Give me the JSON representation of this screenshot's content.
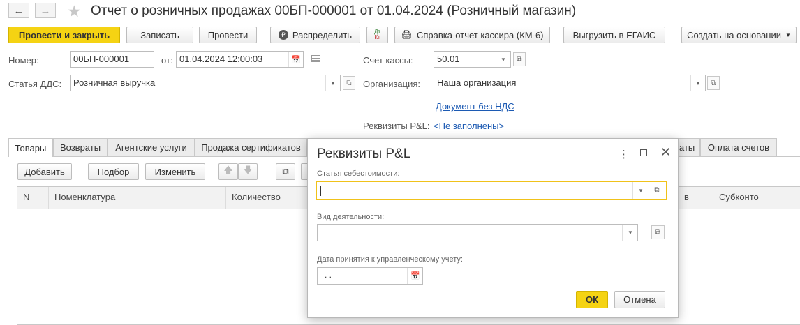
{
  "window": {
    "title": "Отчет о розничных продажах 00БП-000001 от 01.04.2024 (Розничный магазин)",
    "back_icon": "arrow-left-icon",
    "forward_icon": "arrow-right-icon",
    "favorite_icon": "star-icon"
  },
  "toolbar": {
    "post_close": "Провести и закрыть",
    "save": "Записать",
    "post": "Провести",
    "distribute": "Распределить",
    "report_kassir": "Справка-отчет кассира (КМ-6)",
    "egais": "Выгрузить в ЕГАИС",
    "create_based": "Создать на основании",
    "dtkt_dt": "Дт",
    "dtkt_kt": "Кт"
  },
  "header": {
    "number_label": "Номер:",
    "number_value": "00БП-000001",
    "date_label": "от:",
    "date_value": "01.04.2024 12:00:03",
    "kassa_label": "Счет кассы:",
    "kassa_value": "50.01",
    "dds_label": "Статья ДДС:",
    "dds_value": "Розничная выручка",
    "org_label": "Организация:",
    "org_value": "Наша организация",
    "vat_link": "Документ без НДС",
    "pl_label": "Реквизиты P&L:",
    "pl_link": "<Не заполнены>"
  },
  "tabs": {
    "goods": "Товары",
    "returns": "Возвраты",
    "agent": "Агентские услуги",
    "certs": "Продажа сертификатов",
    "hidden_partial": "аты",
    "payments": "Оплата счетов"
  },
  "table_toolbar": {
    "add": "Добавить",
    "pick": "Подбор",
    "change": "Изменить"
  },
  "table": {
    "col_n": "N",
    "col_item": "Номенклатура",
    "col_qty": "Количество",
    "col_hidden_partial": "в",
    "col_subconto": "Субконто"
  },
  "dialog": {
    "title": "Реквизиты P&L",
    "cost_label": "Статья себестоимости:",
    "cost_value": "",
    "activity_label": "Вид деятельности:",
    "activity_value": "",
    "date_label": "Дата принятия к управленческому учету:",
    "date_value": " .  .",
    "ok": "ОК",
    "cancel": "Отмена"
  },
  "colors": {
    "accent": "#f5d313",
    "link": "#1c5ab3",
    "focus": "#f0c21a"
  }
}
